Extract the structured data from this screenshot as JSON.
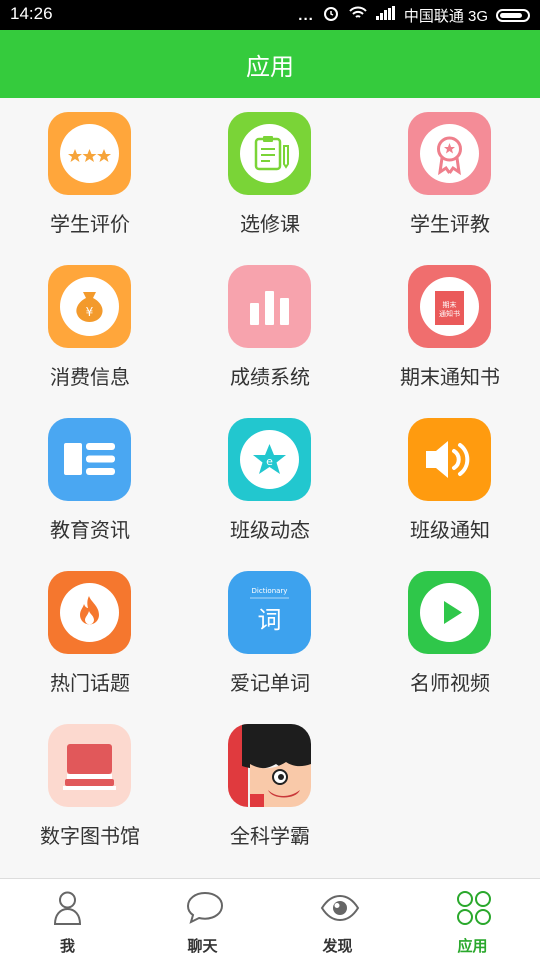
{
  "status_bar": {
    "time": "14:26",
    "carrier": "中国联通 3G",
    "dots": "..."
  },
  "header": {
    "title": "应用"
  },
  "apps": [
    {
      "label": "学生评价",
      "icon": "stars-icon"
    },
    {
      "label": "选修课",
      "icon": "clipboard-icon"
    },
    {
      "label": "学生评教",
      "icon": "award-icon"
    },
    {
      "label": "消费信息",
      "icon": "money-bag-icon"
    },
    {
      "label": "成绩系统",
      "icon": "bar-chart-icon"
    },
    {
      "label": "期末通知书",
      "icon": "notice-icon",
      "icon_text": "期末通知书"
    },
    {
      "label": "教育资讯",
      "icon": "news-icon"
    },
    {
      "label": "班级动态",
      "icon": "star-icon"
    },
    {
      "label": "班级通知",
      "icon": "speaker-icon"
    },
    {
      "label": "热门话题",
      "icon": "fire-icon"
    },
    {
      "label": "爱记单词",
      "icon": "dictionary-icon",
      "icon_title": "Dictionary",
      "icon_char": "词"
    },
    {
      "label": "名师视频",
      "icon": "play-icon"
    },
    {
      "label": "数字图书馆",
      "icon": "books-icon"
    },
    {
      "label": "全科学霸",
      "icon": "cartoon-face-icon"
    }
  ],
  "tabs": [
    {
      "label": "我",
      "icon": "person-icon",
      "active": false
    },
    {
      "label": "聊天",
      "icon": "chat-bubble-icon",
      "active": false
    },
    {
      "label": "发现",
      "icon": "eye-icon",
      "active": false
    },
    {
      "label": "应用",
      "icon": "apps-grid-icon",
      "active": true
    }
  ],
  "colors": {
    "header_green": "#35cb3d",
    "active_tab": "#2aa82c"
  }
}
